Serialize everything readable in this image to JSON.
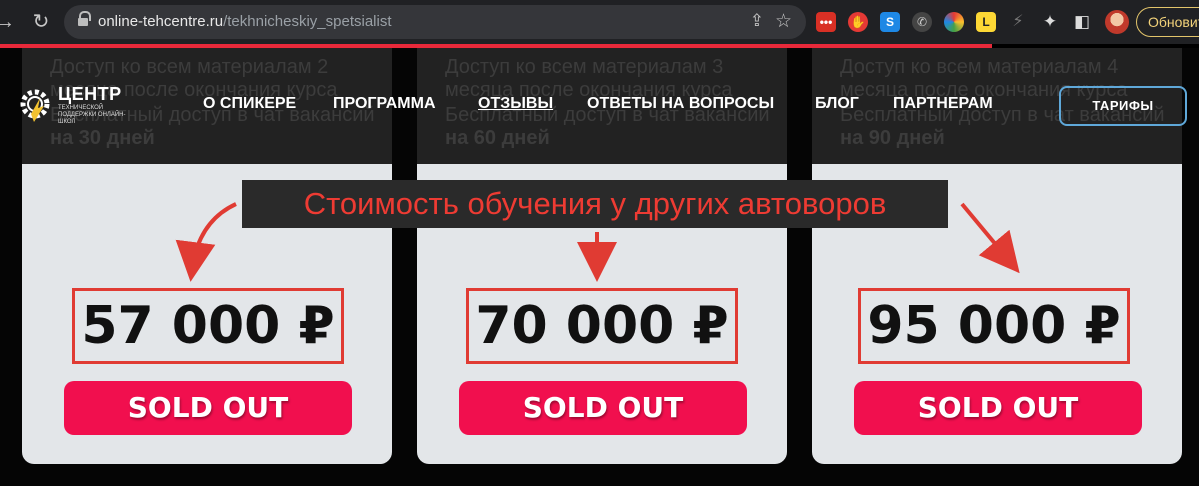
{
  "browser": {
    "url_host": "online-tehcentre.ru",
    "url_path": "/tekhnicheskiy_spetsialist",
    "update_label": "Обновить"
  },
  "site": {
    "logo_name": "ЦЕНТР",
    "logo_tagline": "ТЕХНИЧЕСКОЙ ПОДДЕРЖКИ ОНЛАЙН-ШКОЛ",
    "nav": [
      {
        "label": "О СПИКЕРЕ"
      },
      {
        "label": "ПРОГРАММА"
      },
      {
        "label": "ОТЗЫВЫ"
      },
      {
        "label": "ОТВЕТЫ НА ВОПРОСЫ"
      },
      {
        "label": "БЛОГ"
      },
      {
        "label": "ПАРТНЕРАМ"
      }
    ],
    "tariffs_label": "ТАРИФЫ"
  },
  "annotation": {
    "text": "Стоимость обучения у других автоворов"
  },
  "cards": [
    {
      "access": "Доступ ко всем материалам 2 месяца после окончания курса",
      "jobs_prefix": "Бесплатный доступ в чат вакансий",
      "jobs_period": "на 30 дней",
      "price": "57 000 ₽",
      "button": "SOLD OUT"
    },
    {
      "access": "Доступ ко всем материалам 3 месяца после окончания курса",
      "jobs_prefix": "Бесплатный доступ в чат вакансий",
      "jobs_period": "на 60 дней",
      "price": "70 000 ₽",
      "button": "SOLD OUT"
    },
    {
      "access": "Доступ ко всем материалам 4 месяца после окончания курса",
      "jobs_prefix": "Бесплатный доступ в чат вакансий",
      "jobs_period": "на 90 дней",
      "price": "95 000 ₽",
      "button": "SOLD OUT"
    }
  ],
  "colors": {
    "accent_red": "#f10f4e",
    "annotation_red": "#ee3b33"
  }
}
